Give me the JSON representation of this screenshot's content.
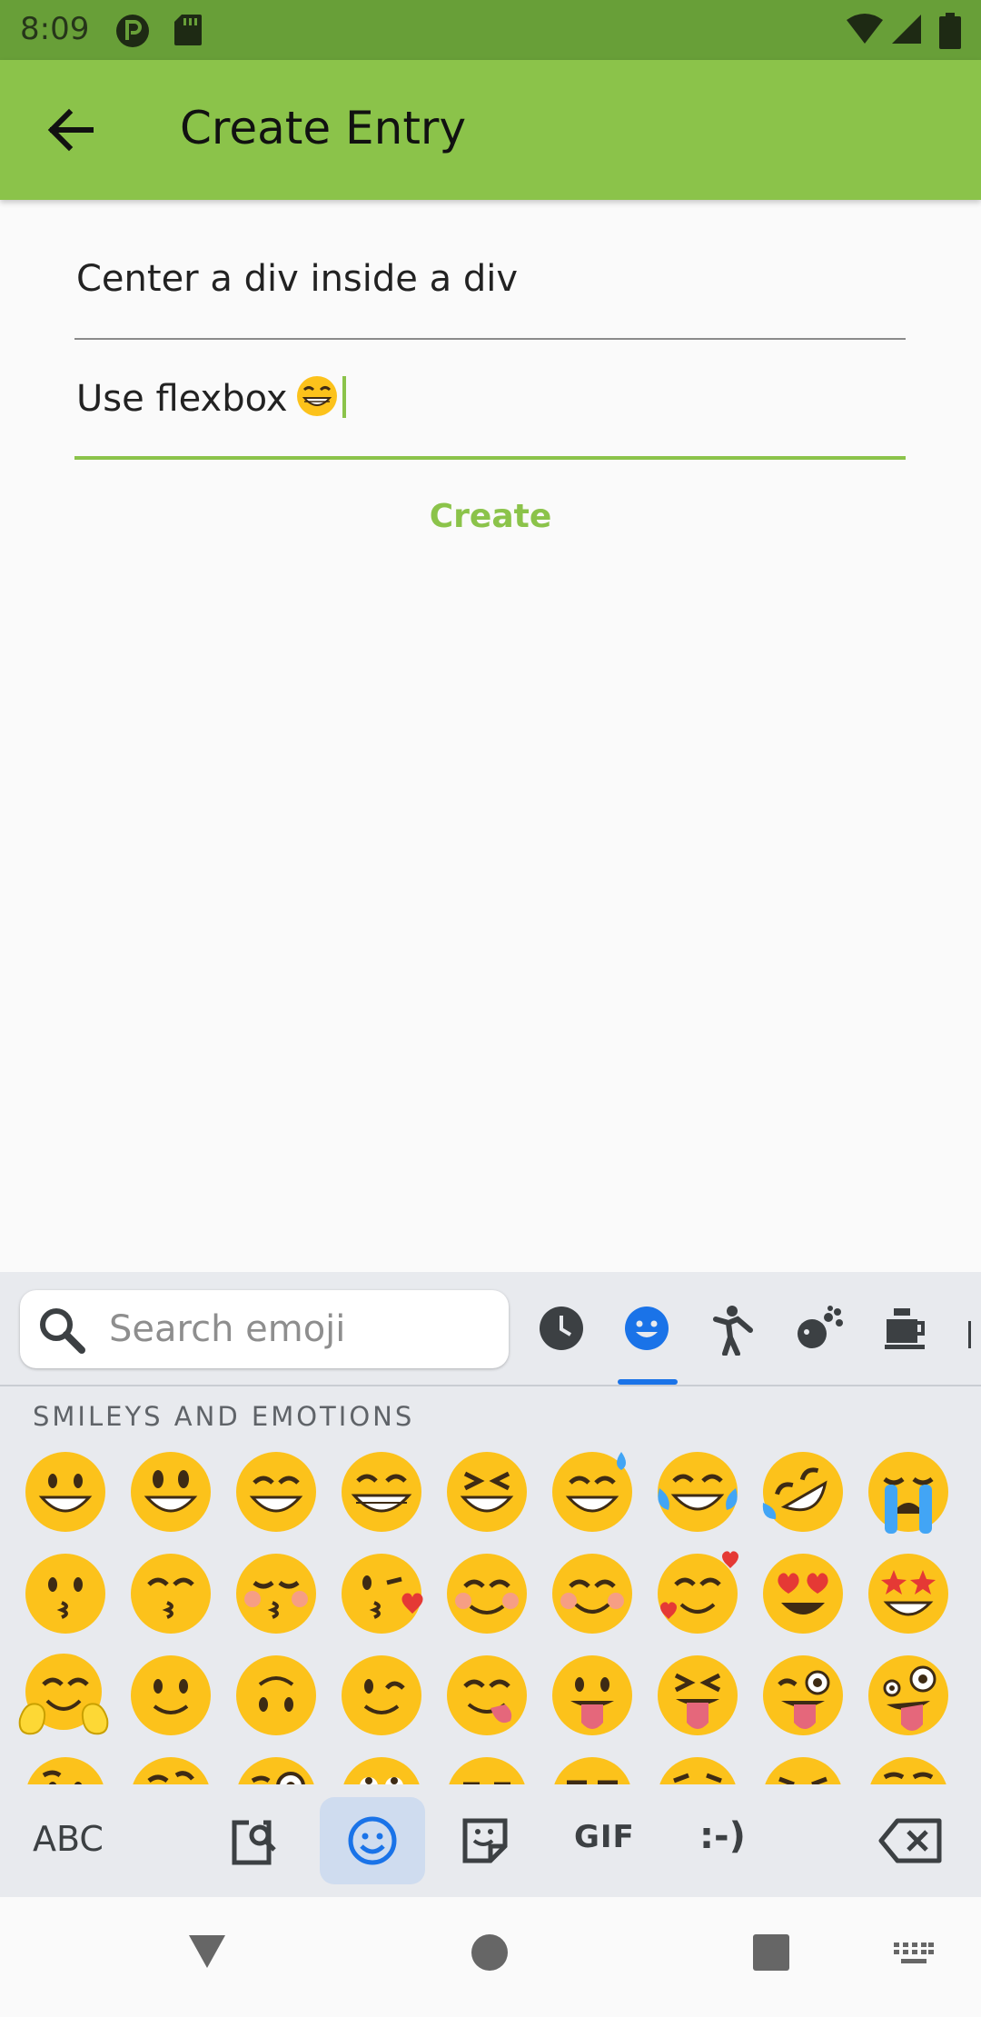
{
  "status_bar": {
    "time": "8:09"
  },
  "app_bar": {
    "title": "Create Entry",
    "back_icon": "arrow-back-icon"
  },
  "form": {
    "title_value": "Center a div inside a div",
    "description_value": "Use flexbox",
    "description_emoji": "beaming-face-emoji",
    "create_label": "Create"
  },
  "keyboard": {
    "search_placeholder": "Search emoji",
    "categories": [
      "recent-icon",
      "smileys-icon",
      "people-icon",
      "animals-icon",
      "food-icon"
    ],
    "section_label": "SMILEYS AND EMOTIONS",
    "abc_label": "ABC",
    "gif_label": "GIF",
    "emoticon_label": ":-)"
  },
  "colors": {
    "status_bar": "#689f38",
    "app_bar": "#8bc34a",
    "accent": "#8bc34a",
    "keyboard_accent": "#1a73e8"
  }
}
